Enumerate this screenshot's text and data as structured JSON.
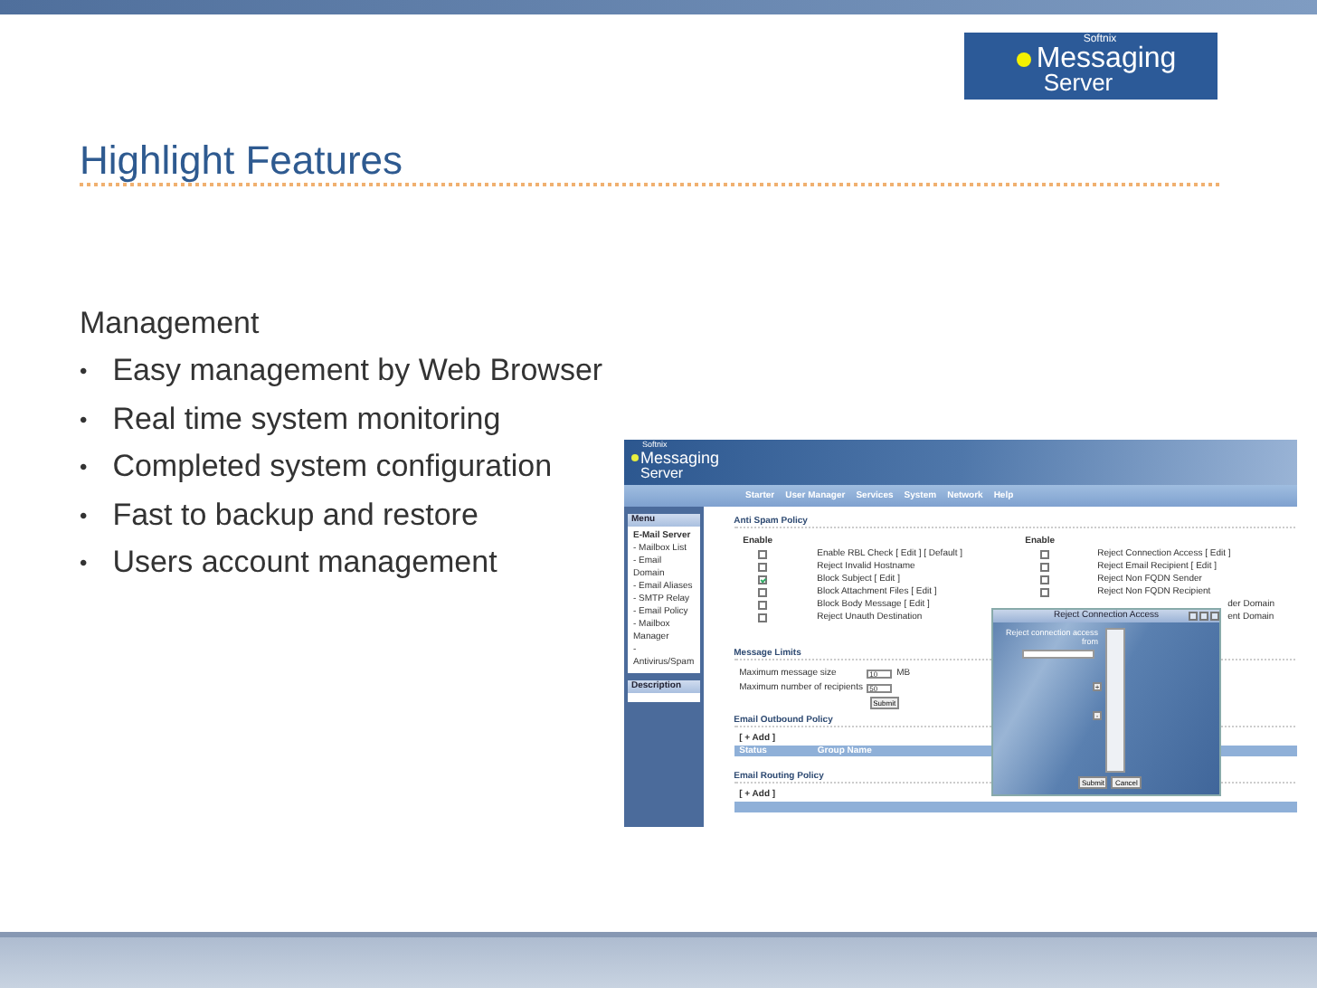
{
  "logo": {
    "brand": "Softnix",
    "line1": "Messaging",
    "line2": "Server"
  },
  "title": "Highlight Features",
  "body": {
    "heading": "Management",
    "bullets": [
      {
        "marker": "•",
        "text": "Easy management by Web Browser"
      },
      {
        "marker": "•",
        "text": "Real time system monitoring"
      },
      {
        "marker": "•",
        "text": "Completed system configuration"
      },
      {
        "marker": "•",
        "text": "Fast to backup and restore"
      },
      {
        "marker": "•",
        "text": "Users account management"
      }
    ]
  },
  "screenshot": {
    "logo": {
      "brand": "Softnix",
      "line1": "Messaging",
      "line2": "Server"
    },
    "nav": [
      "Starter",
      "User Manager",
      "Services",
      "System",
      "Network",
      "Help"
    ],
    "sidebar": {
      "menu_title": "Menu",
      "section": "E-Mail Server",
      "items": [
        "- Mailbox List",
        "- Email Domain",
        "- Email Aliases",
        "- SMTP Relay",
        "- Email Policy",
        "- Mailbox Manager",
        "- Antivirus/Spam"
      ],
      "description_title": "Description"
    },
    "anti_spam": {
      "title": "Anti Spam Policy",
      "enable_headers": [
        "Enable",
        "Enable"
      ],
      "left": [
        {
          "label": "Enable RBL Check [ Edit ] [ Default ]",
          "checked": false
        },
        {
          "label": "Reject Invalid Hostname",
          "checked": false
        },
        {
          "label": "Block Subject [ Edit ]",
          "checked": true
        },
        {
          "label": "Block Attachment Files [ Edit ]",
          "checked": false
        },
        {
          "label": "Block Body Message [ Edit ]",
          "checked": false
        },
        {
          "label": "Reject Unauth Destination",
          "checked": false
        }
      ],
      "right": [
        {
          "kind": "row",
          "label": "Reject Connection Access [ Edit ]",
          "checked": false
        },
        {
          "kind": "row",
          "label": "Reject Email Recipient [ Edit ]",
          "checked": false
        },
        {
          "kind": "row",
          "label": "Reject Non FQDN Sender",
          "checked": false
        },
        {
          "kind": "row",
          "label": "Reject Non FQDN Recipient",
          "checked": false
        },
        {
          "kind": "partial",
          "label": "der Domain"
        },
        {
          "kind": "partial",
          "label": "ent Domain"
        }
      ]
    },
    "message_limits": {
      "title": "Message Limits",
      "fields": [
        {
          "label": "Maximum message size",
          "value": "10",
          "unit": "MB"
        },
        {
          "label": "Maximum number of recipients",
          "value": "50"
        }
      ],
      "submit": "Submit"
    },
    "outbound": {
      "title": "Email Outbound Policy",
      "add": "[ + Add ]",
      "columns": [
        "Status",
        "Group Name"
      ]
    },
    "routing": {
      "title": "Email Routing Policy",
      "add": "[ + Add ]"
    },
    "dialog": {
      "title": "Reject Connection Access",
      "label_line1": "Reject connection access",
      "label_line2": "from",
      "add": "+",
      "remove": "-",
      "buttons": [
        "Submit",
        "Cancel"
      ]
    }
  }
}
